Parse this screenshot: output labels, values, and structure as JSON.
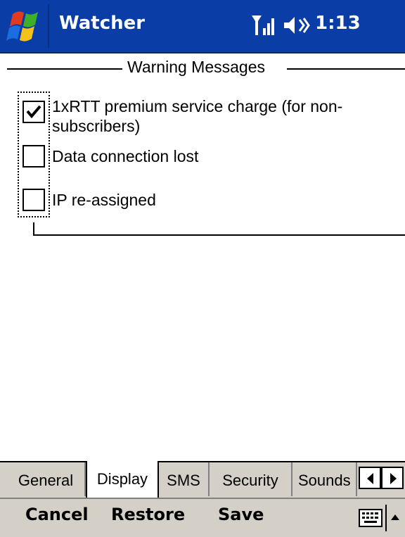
{
  "titlebar": {
    "start_icon": "windows-flag-icon",
    "title": "Watcher",
    "signal_icon": "signal-strength-icon",
    "volume_icon": "speaker-volume-icon",
    "time": "1:13",
    "background_color": "#0a3ea6"
  },
  "group": {
    "title": "Warning Messages",
    "items": [
      {
        "label": "1xRTT premium service charge (for non-subscribers)",
        "label_line1": "1xRTT premium service charge (for non-",
        "label_line2": "subscribers)",
        "checked": true
      },
      {
        "label": "Data connection lost",
        "checked": false
      },
      {
        "label": "IP re-assigned",
        "checked": false
      }
    ]
  },
  "tabs": {
    "items": [
      "General",
      "Display",
      "SMS",
      "Security",
      "Sounds"
    ],
    "active": "Display",
    "scroll_left_icon": "arrow-left-icon",
    "scroll_right_icon": "arrow-right-icon"
  },
  "commandbar": {
    "cancel": "Cancel",
    "restore": "Restore",
    "save": "Save",
    "keyboard_icon": "keyboard-icon",
    "sip_arrow_icon": "arrow-up-icon"
  }
}
